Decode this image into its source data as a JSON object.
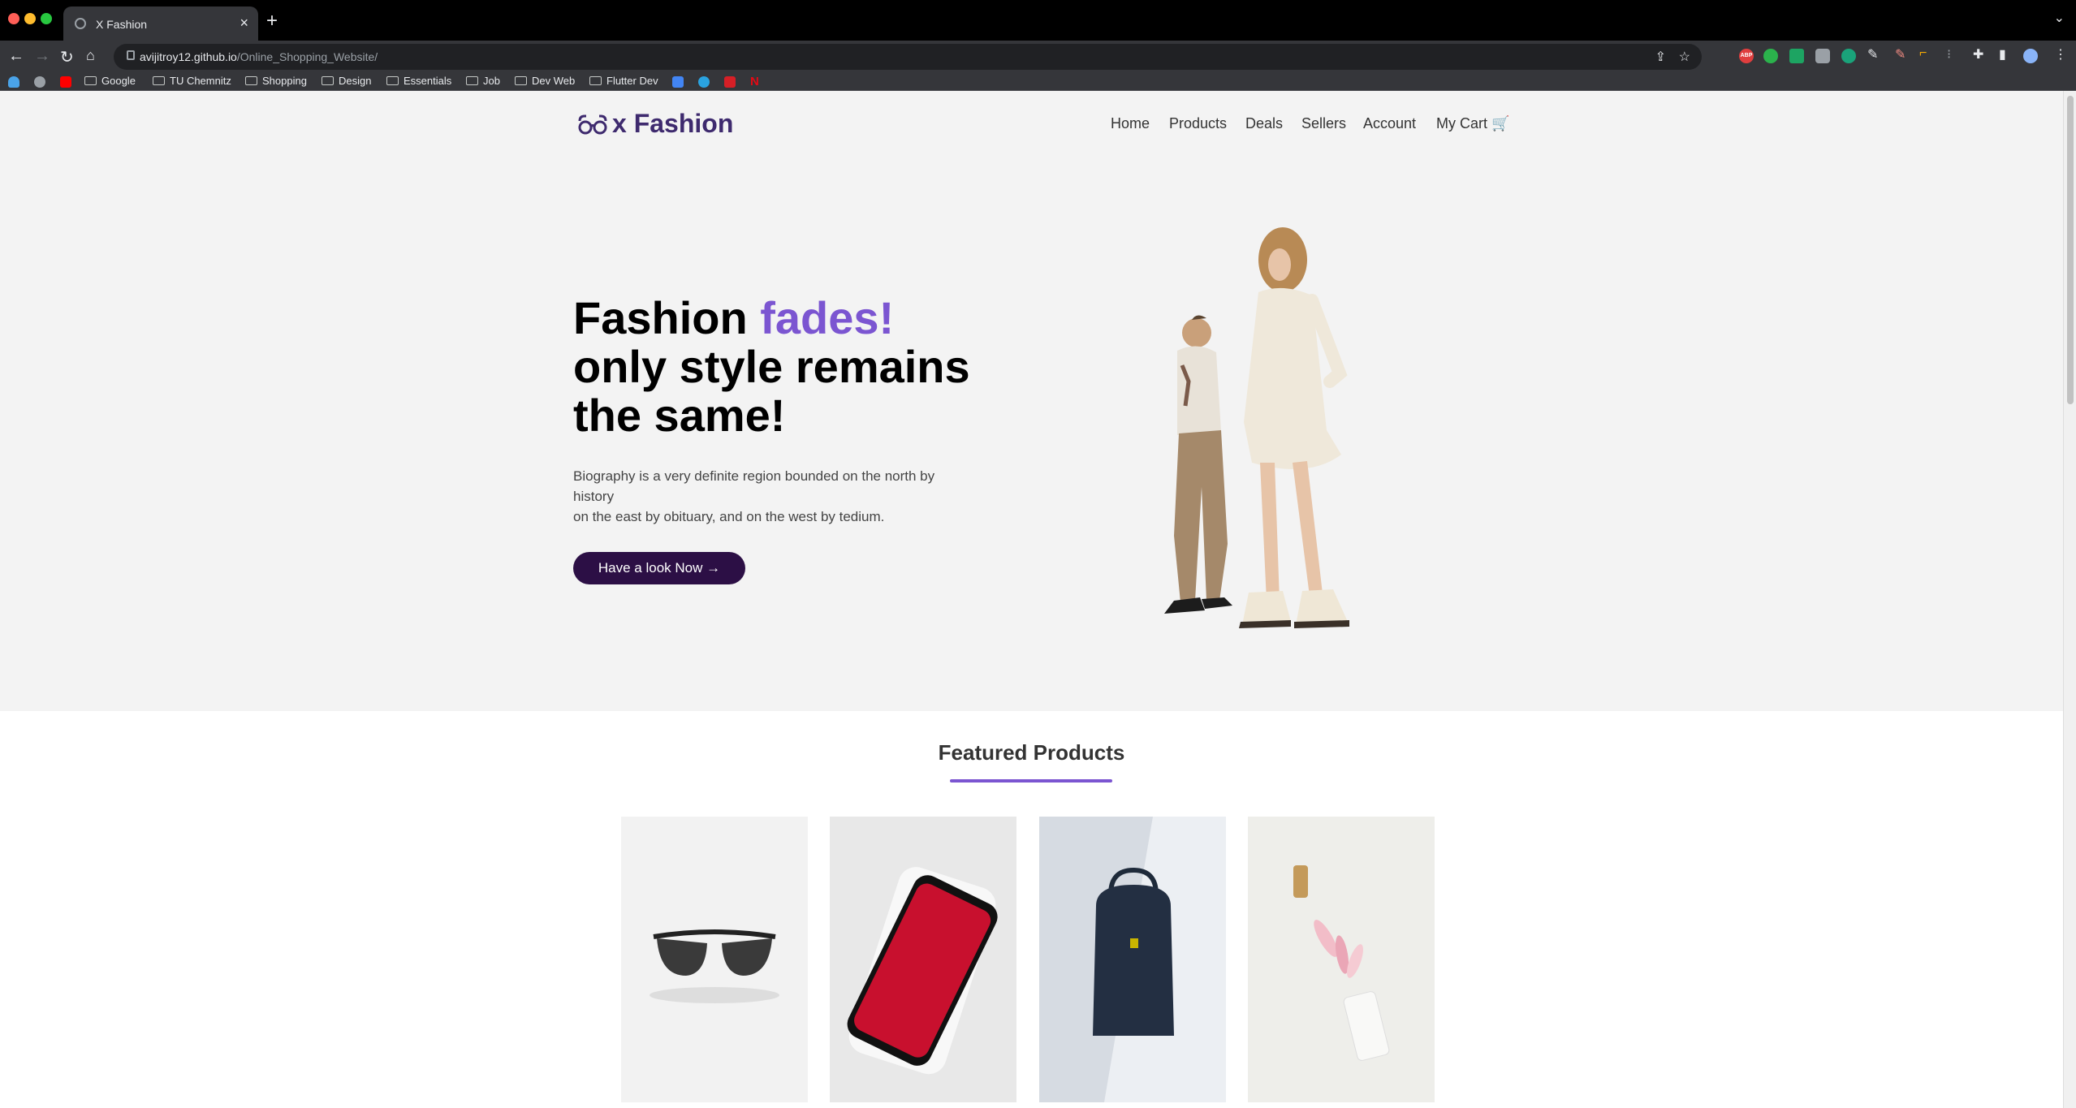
{
  "browser": {
    "tab_title": "X Fashion",
    "url_host": "avijitroy12.github.io",
    "url_path": "/Online_Shopping_Website/",
    "bookmarks": [
      "Google",
      "TU Chemnitz",
      "Shopping",
      "Design",
      "Essentials",
      "Job",
      "Dev Web",
      "Flutter Dev"
    ],
    "ext_abp": "ABP"
  },
  "site": {
    "logo_text": "x Fashion",
    "nav": [
      "Home",
      "Products",
      "Deals",
      "Sellers",
      "Account",
      "My Cart"
    ],
    "cart_icon": "🛒",
    "headline_1": "Fashion ",
    "headline_accent": "fades!",
    "headline_2": "only style remains",
    "headline_3": "the same!",
    "bio_1": "Biography is a very definite region bounded on the north by history",
    "bio_2": "on the east by obituary, and on the west by tedium.",
    "cta": "Have a look Now →",
    "featured_title": "Featured Products",
    "accent_color": "#7b55d1",
    "dark_color": "#2c0f45"
  }
}
